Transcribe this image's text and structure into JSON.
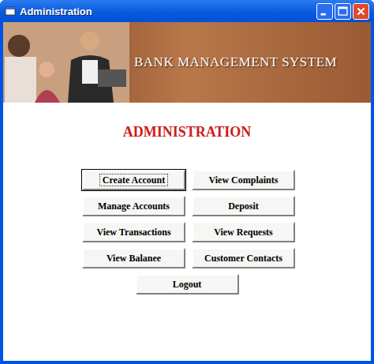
{
  "window": {
    "title": "Administration"
  },
  "banner": {
    "title": "BANK MANAGEMENT SYSTEM"
  },
  "heading": "ADMINISTRATION",
  "buttons": [
    {
      "label": "Create Account",
      "focused": true
    },
    {
      "label": "View Complaints",
      "focused": false
    },
    {
      "label": "Manage Accounts",
      "focused": false
    },
    {
      "label": "Deposit",
      "focused": false
    },
    {
      "label": "View Transactions",
      "focused": false
    },
    {
      "label": "View Requests",
      "focused": false
    },
    {
      "label": "View Balanee",
      "focused": false
    },
    {
      "label": "Customer Contacts",
      "focused": false
    }
  ],
  "logout": {
    "label": "Logout",
    "focused": false
  }
}
